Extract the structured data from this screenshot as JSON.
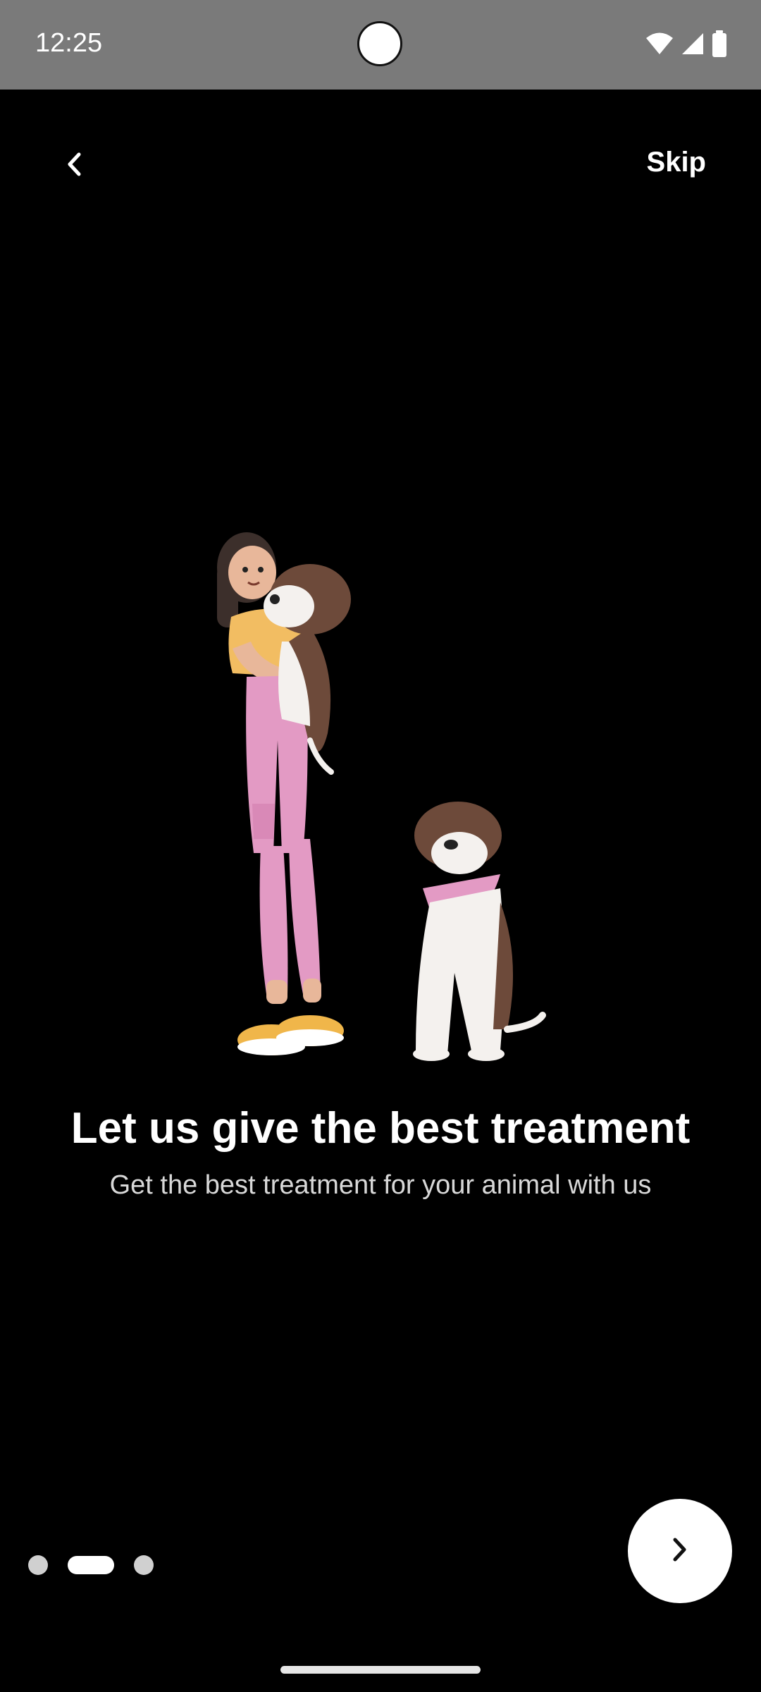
{
  "status_bar": {
    "time": "12:25",
    "icons": [
      "wifi-icon",
      "cell-signal-icon",
      "battery-icon"
    ]
  },
  "nav": {
    "back_icon": "chevron-left-icon",
    "skip_label": "Skip"
  },
  "onboarding": {
    "title": "Let us give the best treatment",
    "subtitle": "Get the best treatment for your animal with us",
    "illustration": "woman-holding-dog-with-sitting-dog-illustration",
    "page_index": 2,
    "page_count": 3
  },
  "next_button": {
    "icon": "chevron-right-icon"
  },
  "colors": {
    "background": "#000000",
    "status_bar": "#7a7a7a",
    "accent": "#ffffff",
    "inactive_dot": "#d0d0d0"
  }
}
